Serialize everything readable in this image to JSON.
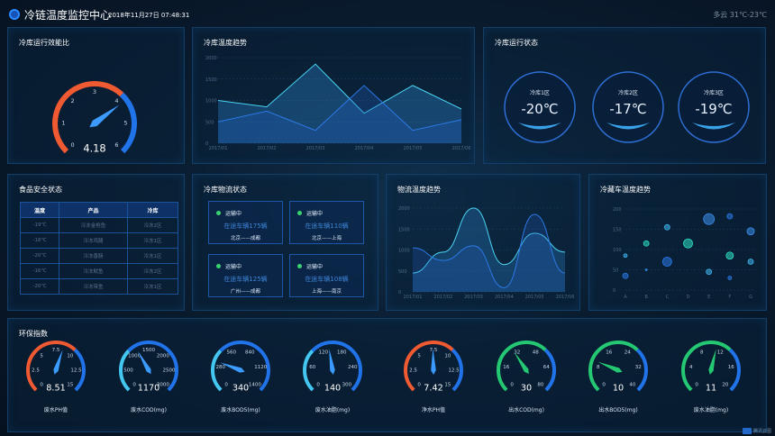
{
  "header": {
    "title": "冷链温度监控中心",
    "datetime": "2018年11月27日 07:48:31",
    "weather": "多云 31℃-23℃"
  },
  "efficiency": {
    "title": "冷库运行效能比",
    "value": "4.18",
    "ticks": [
      "0",
      "1",
      "2",
      "3",
      "4",
      "5",
      "6"
    ],
    "gauge_value": 4.18,
    "gauge_max": 6
  },
  "temp_trend": {
    "title": "冷库温度趋势",
    "y_ticks": [
      "2000",
      "1500",
      "1000",
      "500",
      "0"
    ],
    "x_ticks": [
      "2017/01",
      "2017/02",
      "2017/03",
      "2017/04",
      "2017/05",
      "2017/06"
    ],
    "ylim": [
      0,
      2000
    ],
    "series": [
      {
        "values": [
          1000,
          850,
          1850,
          700,
          1350,
          800
        ],
        "stroke": "#4ad4f2",
        "fill": "rgba(45,135,210,.35)"
      },
      {
        "values": [
          500,
          750,
          300,
          1350,
          300,
          550
        ],
        "stroke": "#2d79e6",
        "fill": "rgba(34,92,190,.30)"
      }
    ]
  },
  "status": {
    "title": "冷库运行状态",
    "zones": [
      {
        "name": "冷库1区",
        "temp": "-20℃"
      },
      {
        "name": "冷库2区",
        "temp": "-17℃"
      },
      {
        "name": "冷库3区",
        "temp": "-19℃"
      }
    ]
  },
  "food": {
    "title": "食品安全状态",
    "headers": [
      "温度",
      "产品",
      "冷库"
    ],
    "rows": [
      [
        "-19℃",
        "冷冻金枪鱼",
        "冷冻2区"
      ],
      [
        "-18℃",
        "冷冻鸡腿",
        "冷冻1区"
      ],
      [
        "-20℃",
        "冷冻香肠",
        "冷冻1区"
      ],
      [
        "-16℃",
        "冷冻鱿鱼",
        "冷冻2区"
      ],
      [
        "-20℃",
        "冷冻带鱼",
        "冷冻1区"
      ]
    ]
  },
  "logistics": {
    "title": "冷库物流状态",
    "cards": [
      {
        "status": "运输中",
        "text": "在途车辆175辆",
        "route": "北京——成都"
      },
      {
        "status": "运输中",
        "text": "在途车辆110辆",
        "route": "北京——上海"
      },
      {
        "status": "运输中",
        "text": "在途车辆125辆",
        "route": "广州——成都"
      },
      {
        "status": "运输中",
        "text": "在途车辆108辆",
        "route": "上海——南京"
      }
    ]
  },
  "flow_trend": {
    "title": "物流温度趋势",
    "y_ticks": [
      "2000",
      "1500",
      "1000",
      "500",
      "0"
    ],
    "x_ticks": [
      "2017/01",
      "2017/02",
      "2017/03",
      "2017/04",
      "2017/05",
      "2017/06"
    ],
    "ylim": [
      0,
      2000
    ],
    "series": [
      {
        "values": [
          450,
          950,
          2000,
          650,
          1400,
          950
        ],
        "stroke": "#4ad4f2",
        "fill": "rgba(45,135,210,.3)"
      },
      {
        "values": [
          1050,
          750,
          1100,
          100,
          1850,
          450
        ],
        "stroke": "#2d79e6",
        "fill": "rgba(34,92,190,.25)"
      }
    ]
  },
  "reefer": {
    "title": "冷藏车温度趋势",
    "y_ticks": [
      "200",
      "150",
      "100",
      "50",
      "0"
    ],
    "x_ticks": [
      "A",
      "B",
      "C",
      "D",
      "E",
      "F",
      "G"
    ],
    "ylim": [
      0,
      200
    ],
    "points": [
      {
        "x": "A",
        "y": 85,
        "r": 2
      },
      {
        "x": "A",
        "y": 35,
        "r": 3
      },
      {
        "x": "B",
        "y": 115,
        "r": 3
      },
      {
        "x": "B",
        "y": 50,
        "r": 1
      },
      {
        "x": "C",
        "y": 155,
        "r": 3
      },
      {
        "x": "C",
        "y": 70,
        "r": 5
      },
      {
        "x": "D",
        "y": 115,
        "r": 5
      },
      {
        "x": "E",
        "y": 175,
        "r": 6
      },
      {
        "x": "E",
        "y": 45,
        "r": 3
      },
      {
        "x": "F",
        "y": 182,
        "r": 3
      },
      {
        "x": "F",
        "y": 85,
        "r": 4
      },
      {
        "x": "G",
        "y": 145,
        "r": 4
      },
      {
        "x": "G",
        "y": 70,
        "r": 3
      },
      {
        "x": "F",
        "y": 30,
        "r": 2
      }
    ]
  },
  "env": {
    "title": "环保指数",
    "gauges": [
      {
        "value": "8.51",
        "label": "废水PH值",
        "ticks": [
          "0",
          "2.5",
          "5",
          "7.5",
          "10",
          "12.5",
          "15"
        ],
        "scheme": "orange",
        "needle": 8.51,
        "max": 15
      },
      {
        "value": "1170",
        "label": "废水COD(mg)",
        "ticks": [
          "0",
          "500",
          "1000",
          "1500",
          "2000",
          "2500",
          "3000"
        ],
        "scheme": "blue",
        "needle": 1170,
        "max": 3000
      },
      {
        "value": "340",
        "label": "废水BOD5(mg)",
        "ticks": [
          "0",
          "280",
          "560",
          "840",
          "1120",
          "1400"
        ],
        "scheme": "blue",
        "needle": 340,
        "max": 1400
      },
      {
        "value": "140",
        "label": "废水油脂(mg)",
        "ticks": [
          "0",
          "60",
          "120",
          "180",
          "240",
          "300"
        ],
        "scheme": "blue",
        "needle": 140,
        "max": 300
      },
      {
        "value": "7.42",
        "label": "净水PH值",
        "ticks": [
          "0",
          "2.5",
          "5",
          "7.5",
          "10",
          "12.5",
          "15"
        ],
        "scheme": "orange",
        "needle": 7.42,
        "max": 15
      },
      {
        "value": "30",
        "label": "出水COD(mg)",
        "ticks": [
          "0",
          "16",
          "32",
          "48",
          "64",
          "80"
        ],
        "scheme": "green",
        "needle": 30,
        "max": 80
      },
      {
        "value": "10",
        "label": "出水BOD5(mg)",
        "ticks": [
          "0",
          "8",
          "16",
          "24",
          "32",
          "40"
        ],
        "scheme": "green",
        "needle": 10,
        "max": 40
      },
      {
        "value": "11",
        "label": "废水油脂(mg)",
        "ticks": [
          "0",
          "4",
          "8",
          "12",
          "16",
          "20"
        ],
        "scheme": "green",
        "needle": 11,
        "max": 20
      }
    ]
  },
  "colors": {
    "orange": "#f05a32",
    "blue": "#2173ea",
    "green": "#24c873",
    "cyan": "#43c7f0",
    "needle": "#3c9bff"
  },
  "brand": "腾讯云图"
}
